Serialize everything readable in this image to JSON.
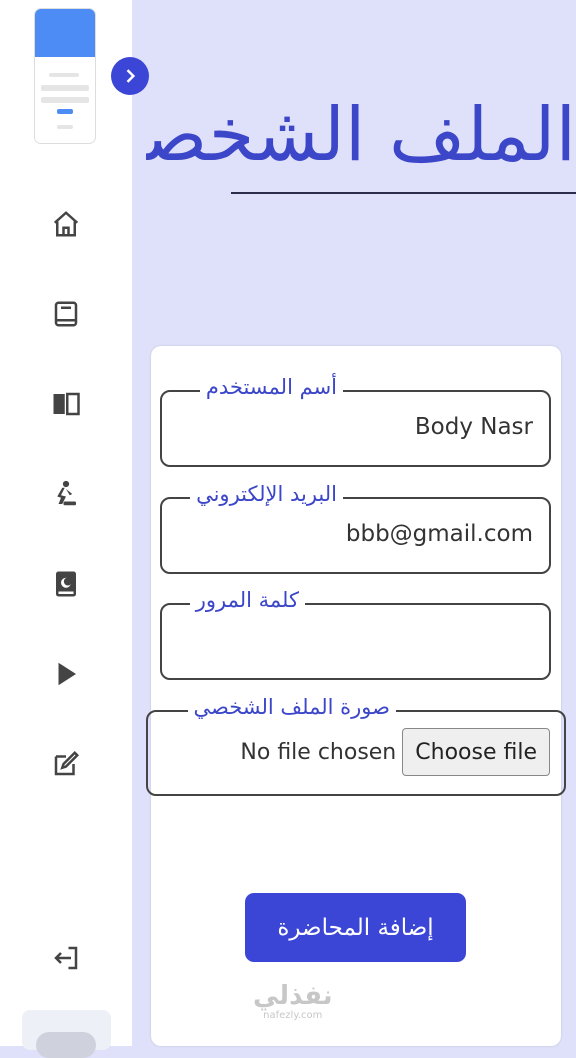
{
  "page": {
    "title": "الملف الشخصي"
  },
  "form": {
    "username_label": "أسم المستخدم",
    "username_value": "Body Nasr",
    "email_label": "البريد الإلكتروني",
    "email_value": "bbb@gmail.com",
    "password_label": "كلمة المرور",
    "password_value": "",
    "photo_label": "صورة الملف الشخصي",
    "file_status": "No file chosen",
    "file_button": "Choose file",
    "submit_label": "إضافة المحاضرة"
  },
  "sidebar": {
    "icons": [
      "home-icon",
      "book-icon",
      "open-book-icon",
      "prayer-icon",
      "quran-icon",
      "play-icon",
      "edit-icon",
      "logout-icon"
    ]
  },
  "watermark": {
    "ar": "نفذلي",
    "en": "nafezly.com"
  },
  "colors": {
    "accent": "#3c46d6",
    "page_bg": "#dfe0fa",
    "title": "#3c46c8"
  }
}
